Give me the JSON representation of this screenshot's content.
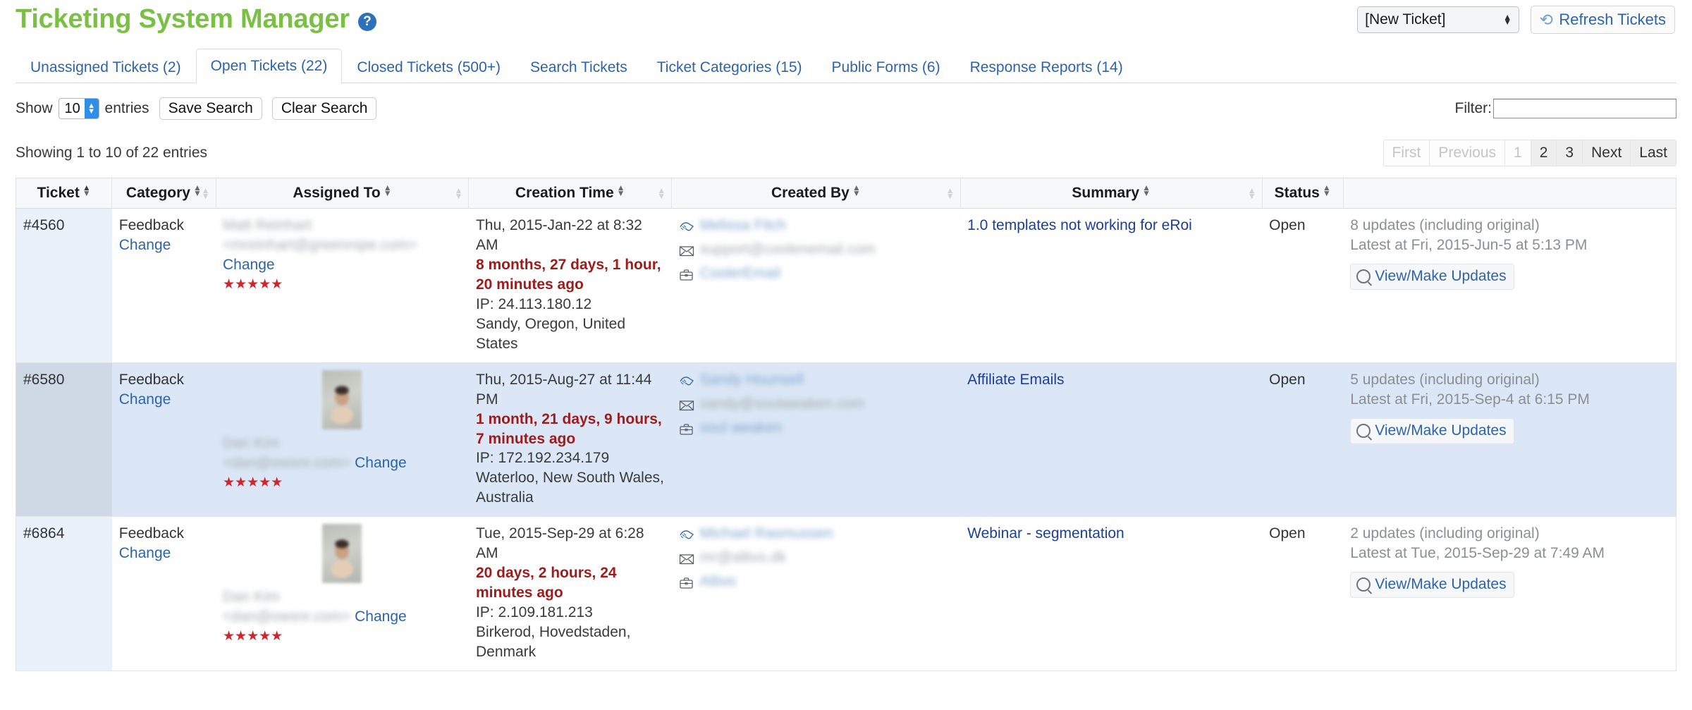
{
  "header": {
    "title": "Ticketing System Manager",
    "help_icon": "question-mark-icon",
    "new_ticket_select_value": "[New Ticket]",
    "refresh_label": "Refresh Tickets",
    "refresh_icon": "refresh-icon"
  },
  "tabs": [
    {
      "label": "Unassigned Tickets (2)",
      "active": false
    },
    {
      "label": "Open Tickets (22)",
      "active": true
    },
    {
      "label": "Closed Tickets (500+)",
      "active": false
    },
    {
      "label": "Search Tickets",
      "active": false
    },
    {
      "label": "Ticket Categories (15)",
      "active": false
    },
    {
      "label": "Public Forms (6)",
      "active": false
    },
    {
      "label": "Response Reports (14)",
      "active": false
    }
  ],
  "controls": {
    "show_label": "Show",
    "entries_label": "entries",
    "page_length_value": "10",
    "save_search_label": "Save Search",
    "clear_search_label": "Clear Search",
    "filter_label": "Filter:",
    "filter_value": "",
    "filter_placeholder": ""
  },
  "info": {
    "showing": "Showing 1 to 10 of 22 entries",
    "pagination": [
      {
        "label": "First",
        "state": "disabled"
      },
      {
        "label": "Previous",
        "state": "disabled"
      },
      {
        "label": "1",
        "state": "current"
      },
      {
        "label": "2",
        "state": "enabled"
      },
      {
        "label": "3",
        "state": "enabled"
      },
      {
        "label": "Next",
        "state": "enabled"
      },
      {
        "label": "Last",
        "state": "enabled"
      }
    ]
  },
  "table": {
    "columns": [
      {
        "label": "Ticket",
        "sort": "asc"
      },
      {
        "label": "Category",
        "sort": "none"
      },
      {
        "label": "Assigned To",
        "sort": "none"
      },
      {
        "label": "Creation Time",
        "sort": "none"
      },
      {
        "label": "Created By",
        "sort": "none"
      },
      {
        "label": "Summary",
        "sort": "none"
      },
      {
        "label": "Status",
        "sort": "none"
      },
      {
        "label": "",
        "sort": "none"
      }
    ],
    "rows": [
      {
        "ticket": "#4560",
        "category": "Feedback",
        "category_change": "Change",
        "assigned_name": "Matt Reinhart",
        "assigned_email": "<mreinhart@greenrope.com>",
        "assigned_change": "Change",
        "assigned_stars": "★★★★★",
        "has_avatar": false,
        "creation_abs": "Thu, 2015-Jan-22 at 8:32 AM",
        "creation_rel": "8 months, 27 days, 1 hour, 20 minutes ago",
        "creation_ip": "IP: 24.113.180.12",
        "creation_loc": "Sandy, Oregon, United States",
        "created_by_person": "Melissa Fitch",
        "created_by_email": "support@coolenemail.com",
        "created_by_company": "CoolerEmail",
        "summary": "1.0 templates not working for eRoi",
        "status": "Open",
        "updates_count": "8 updates (including original)",
        "updates_latest": "Latest at Fri, 2015-Jun-5 at 5:13 PM",
        "updates_button": "View/Make Updates"
      },
      {
        "ticket": "#6580",
        "category": "Feedback",
        "category_change": "Change",
        "assigned_name": "Dan Kim",
        "assigned_email": "<dan@owsnr.com>",
        "assigned_change": "Change",
        "assigned_stars": "★★★★★",
        "has_avatar": true,
        "creation_abs": "Thu, 2015-Aug-27 at 11:44 PM",
        "creation_rel": "1 month, 21 days, 9 hours, 7 minutes ago",
        "creation_ip": "IP: 172.192.234.179",
        "creation_loc": "Waterloo, New South Wales, Australia",
        "created_by_person": "Sandy Hounsell",
        "created_by_email": "sandy@soulawaken.com",
        "created_by_company": "soul awaken",
        "summary": "Affiliate Emails",
        "status": "Open",
        "updates_count": "5 updates (including original)",
        "updates_latest": "Latest at Fri, 2015-Sep-4 at 6:15 PM",
        "updates_button": "View/Make Updates"
      },
      {
        "ticket": "#6864",
        "category": "Feedback",
        "category_change": "Change",
        "assigned_name": "Dan Kim",
        "assigned_email": "<dan@owsnr.com>",
        "assigned_change": "Change",
        "assigned_stars": "★★★★★",
        "has_avatar": true,
        "creation_abs": "Tue, 2015-Sep-29 at 6:28 AM",
        "creation_rel": "20 days, 2 hours, 24 minutes ago",
        "creation_ip": "IP: 2.109.181.213",
        "creation_loc": "Birkerod, Hovedstaden, Denmark",
        "created_by_person": "Michael Rasmussen",
        "created_by_email": "mr@altivo.dk",
        "created_by_company": "Altivo",
        "summary": "Webinar - segmentation",
        "status": "Open",
        "updates_count": "2 updates (including original)",
        "updates_latest": "Latest at Tue, 2015-Sep-29 at 7:49 AM",
        "updates_button": "View/Make Updates"
      }
    ]
  },
  "icons": {
    "handshake": "handshake-icon",
    "envelope": "envelope-icon",
    "briefcase": "briefcase-icon",
    "magnifier": "magnifier-icon"
  },
  "colors": {
    "title_green": "#7ac143",
    "link_blue": "#2d64a8",
    "relative_time_red": "#9e1b1b",
    "star_red": "#d0262b",
    "row_highlight": "#dbe7f6"
  }
}
